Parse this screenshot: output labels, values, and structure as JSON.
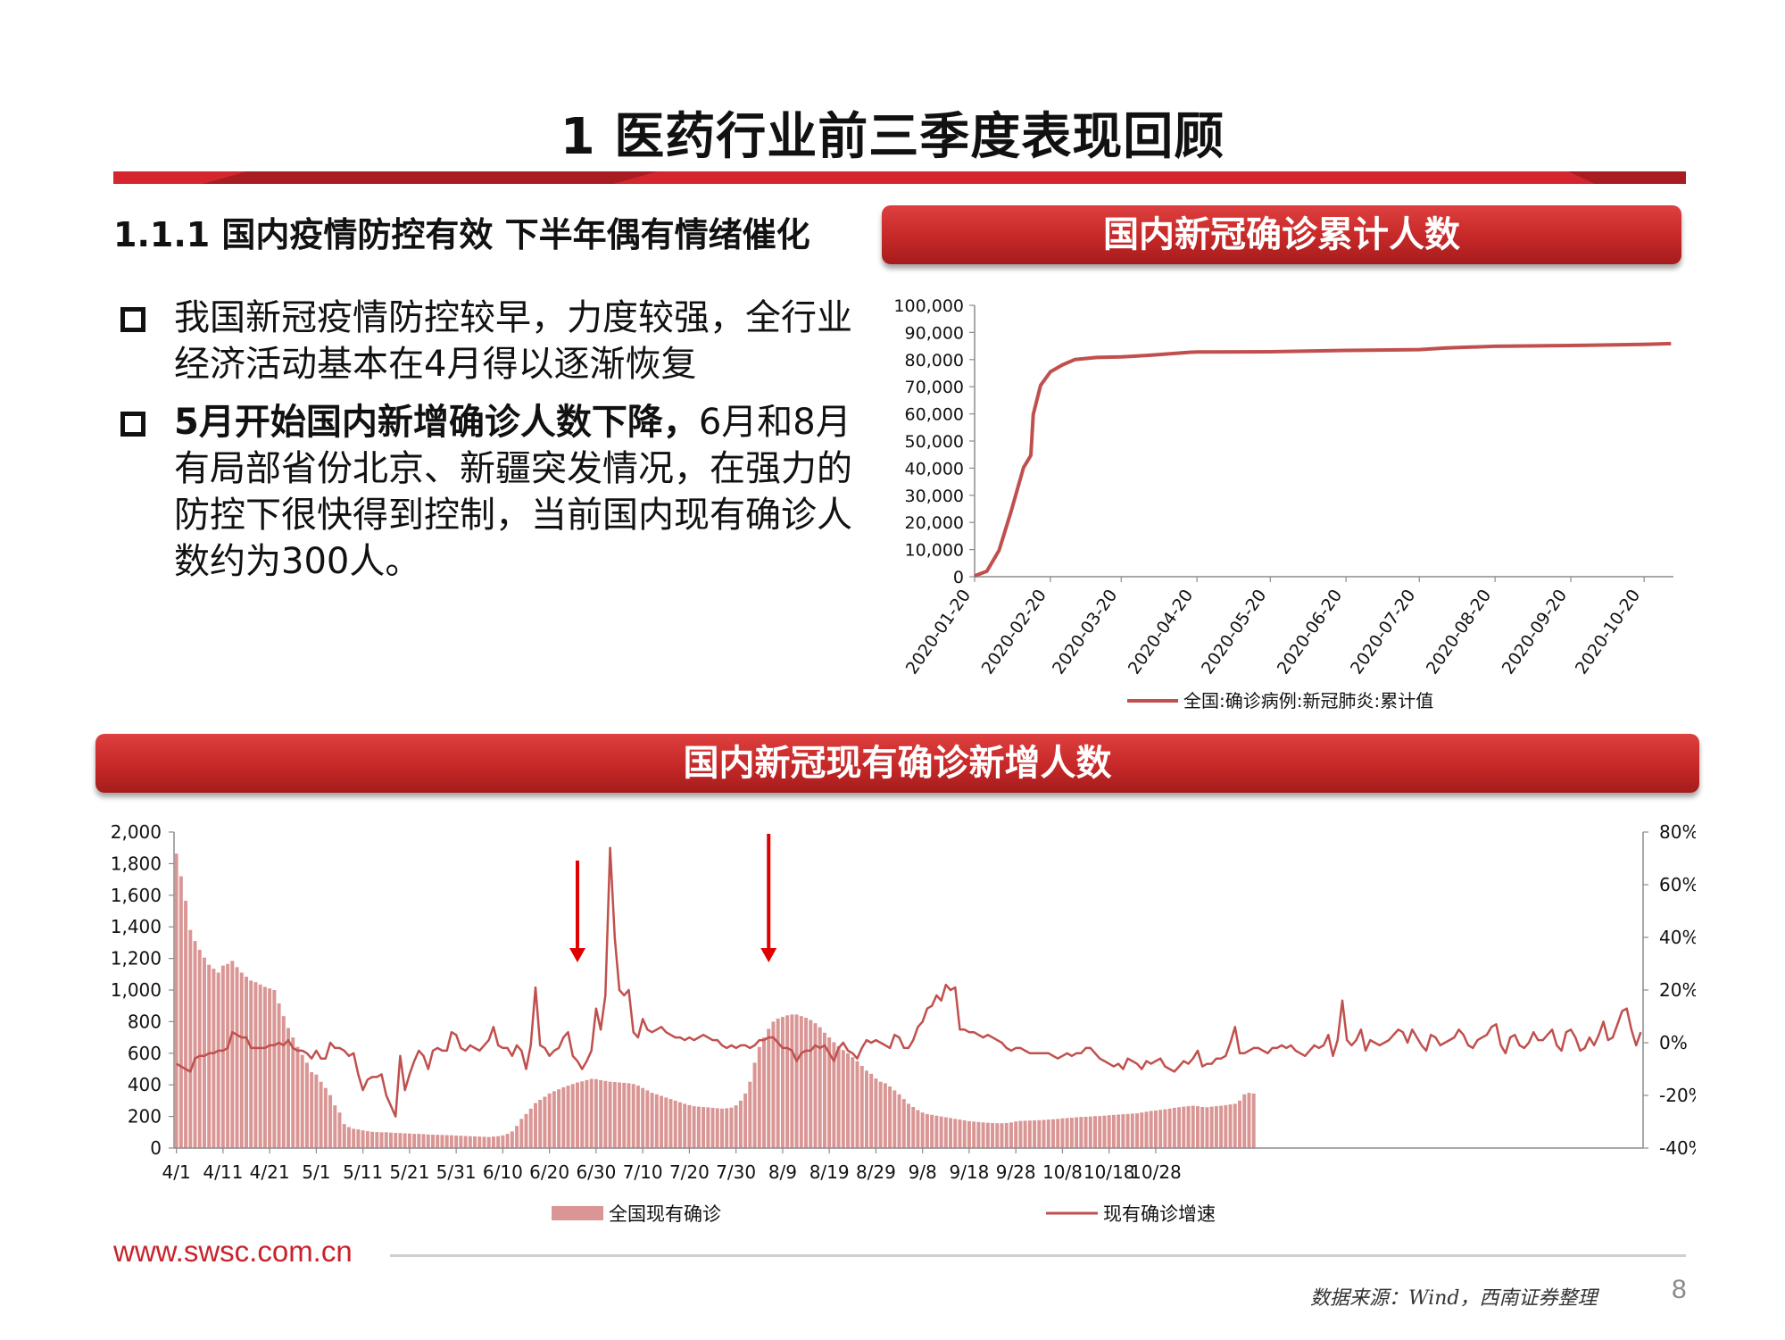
{
  "header": {
    "title": "1 医药行业前三季度表现回顾"
  },
  "section": {
    "heading": "1.1.1 国内疫情防控有效 下半年偶有情绪催化",
    "bullets": [
      {
        "bold": "",
        "text": "我国新冠疫情防控较早，力度较强，全行业经济活动基本在4月得以逐渐恢复"
      },
      {
        "bold": "5月开始国内新增确诊人数下降，",
        "text": "6月和8月有局部省份北京、新疆突发情况，在强力的防控下很快得到控制，当前国内现有确诊人数约为300人。"
      }
    ]
  },
  "colors": {
    "brand_red": "#c8232c",
    "line": "#c0504d",
    "bar": "#d99694",
    "arrow": "#e00000"
  },
  "chart_data": [
    {
      "type": "line",
      "title": "国内新冠确诊累计人数",
      "xlabel": "",
      "ylabel": "",
      "ylim": [
        0,
        100000
      ],
      "yticks": [
        "0",
        "10,000",
        "20,000",
        "30,000",
        "40,000",
        "50,000",
        "60,000",
        "70,000",
        "80,000",
        "90,000",
        "100,000"
      ],
      "xticks": [
        "2020-01-20",
        "2020-02-20",
        "2020-03-20",
        "2020-04-20",
        "2020-05-20",
        "2020-06-20",
        "2020-07-20",
        "2020-08-20",
        "2020-09-20",
        "2020-10-20"
      ],
      "grid": false,
      "legend": "bottom",
      "series": [
        {
          "name": "全国:确诊病例:新冠肺炎:累计值",
          "x": [
            "2020-01-20",
            "2020-01-25",
            "2020-01-30",
            "2020-02-04",
            "2020-02-09",
            "2020-02-12",
            "2020-02-13",
            "2020-02-16",
            "2020-02-20",
            "2020-02-25",
            "2020-03-01",
            "2020-03-10",
            "2020-03-20",
            "2020-04-01",
            "2020-04-17",
            "2020-04-20",
            "2020-05-20",
            "2020-06-20",
            "2020-07-20",
            "2020-07-31",
            "2020-08-20",
            "2020-09-20",
            "2020-10-20",
            "2020-10-31"
          ],
          "values": [
            300,
            2000,
            9700,
            24300,
            40200,
            44700,
            59800,
            70500,
            75500,
            78100,
            80000,
            80800,
            81000,
            81600,
            82700,
            82800,
            82900,
            83400,
            83700,
            84300,
            84900,
            85200,
            85600,
            85900
          ]
        }
      ]
    },
    {
      "type": "bar",
      "title": "国内新冠现有确诊新增人数",
      "xlabel": "",
      "ylabel": "",
      "ylim": [
        0,
        2000
      ],
      "y2lim": [
        -40,
        80
      ],
      "yticks": [
        "0",
        "200",
        "400",
        "600",
        "800",
        "1,000",
        "1,200",
        "1,400",
        "1,600",
        "1,800",
        "2,000"
      ],
      "y2ticks": [
        "-40%",
        "-20%",
        "0%",
        "20%",
        "40%",
        "60%",
        "80%"
      ],
      "xticks": [
        "4/1",
        "4/11",
        "4/21",
        "5/1",
        "5/11",
        "5/21",
        "5/31",
        "6/10",
        "6/20",
        "6/30",
        "7/10",
        "7/20",
        "7/30",
        "8/9",
        "8/19",
        "8/29",
        "9/8",
        "9/18",
        "9/28",
        "10/8",
        "10/18",
        "10/28"
      ],
      "legend": "bottom",
      "annotations": [
        {
          "type": "arrow",
          "x": "6/26"
        },
        {
          "type": "arrow",
          "x": "8/6"
        }
      ],
      "series": [
        {
          "name": "全国现有确诊",
          "axis": "left",
          "kind": "bar",
          "values": [
            1863,
            1720,
            1565,
            1380,
            1310,
            1255,
            1205,
            1160,
            1135,
            1110,
            1155,
            1165,
            1185,
            1145,
            1110,
            1085,
            1060,
            1050,
            1035,
            1020,
            1010,
            1000,
            915,
            835,
            760,
            700,
            640,
            590,
            540,
            480,
            465,
            420,
            380,
            335,
            270,
            225,
            152,
            133,
            122,
            118,
            112,
            107,
            103,
            101,
            100,
            100,
            98,
            96,
            95,
            93,
            92,
            90,
            90,
            88,
            86,
            85,
            84,
            83,
            82,
            81,
            79,
            78,
            76,
            75,
            74,
            73,
            72,
            70,
            73,
            75,
            80,
            90,
            105,
            140,
            185,
            215,
            250,
            285,
            305,
            325,
            345,
            360,
            372,
            385,
            395,
            405,
            415,
            422,
            430,
            438,
            436,
            430,
            425,
            420,
            418,
            415,
            413,
            410,
            405,
            395,
            380,
            365,
            350,
            340,
            330,
            320,
            310,
            300,
            290,
            280,
            272,
            265,
            262,
            260,
            258,
            255,
            252,
            250,
            252,
            256,
            270,
            300,
            345,
            420,
            540,
            640,
            700,
            755,
            800,
            820,
            830,
            840,
            845,
            845,
            835,
            825,
            810,
            790,
            765,
            730,
            700,
            670,
            645,
            620,
            600,
            575,
            550,
            520,
            490,
            470,
            440,
            420,
            410,
            390,
            365,
            340,
            310,
            280,
            260,
            240,
            225,
            215,
            210,
            205,
            200,
            195,
            190,
            185,
            180,
            175,
            170,
            168,
            165,
            162,
            160,
            158,
            157,
            157,
            158,
            162,
            168,
            172,
            173,
            174,
            175,
            176,
            178,
            180,
            182,
            185,
            188,
            190,
            192,
            195,
            197,
            198,
            200,
            202,
            203,
            205,
            208,
            210,
            212,
            214,
            216,
            218,
            220,
            225,
            230,
            235,
            238,
            242,
            245,
            250,
            255,
            258,
            262,
            265,
            268,
            265,
            260,
            258,
            262,
            265,
            268,
            272,
            276,
            280,
            300,
            340,
            350,
            345
          ]
        },
        {
          "name": "现有确诊增速",
          "axis": "right",
          "kind": "line",
          "values": [
            -8,
            -9,
            -10,
            -11,
            -6,
            -5,
            -5,
            -4,
            -4,
            -3,
            -3,
            -2,
            4,
            3,
            2,
            2,
            -2,
            -2,
            -2,
            -2,
            -1,
            -1,
            0,
            -1,
            1,
            -2,
            -3,
            -3,
            -4,
            -6,
            -3,
            -6,
            -6,
            0,
            -2,
            -2,
            -3,
            -5,
            -4,
            -12,
            -18,
            -14,
            -13,
            -13,
            -12,
            -20,
            -24,
            -28,
            -5,
            -18,
            -12,
            -7,
            -3,
            -5,
            -10,
            -3,
            -2,
            -3,
            -3,
            4,
            3,
            -2,
            -3,
            -1,
            -2,
            -3,
            -1,
            1,
            6,
            -1,
            -2,
            -2,
            -5,
            -1,
            -3,
            -10,
            -1,
            21,
            -1,
            -2,
            -5,
            -3,
            -2,
            2,
            4,
            -5,
            -7,
            -10,
            -7,
            -3,
            13,
            5,
            18,
            74,
            40,
            20,
            18,
            20,
            4,
            2,
            9,
            5,
            4,
            5,
            6,
            4,
            3,
            2,
            2,
            1,
            2,
            1,
            2,
            3,
            2,
            1,
            1,
            -1,
            -2,
            -1,
            -2,
            -1,
            -1,
            -2,
            -1,
            1,
            1,
            2,
            2,
            0,
            -2,
            -2,
            -3,
            -7,
            -4,
            -3,
            -3,
            -1,
            -2,
            -1,
            -4,
            -7,
            -2,
            0,
            -3,
            -4,
            -6,
            -2,
            1,
            0,
            1,
            0,
            -1,
            -2,
            3,
            2,
            -2,
            -2,
            1,
            6,
            8,
            13,
            14,
            18,
            16,
            22,
            20,
            21,
            5,
            5,
            4,
            4,
            3,
            2,
            3,
            2,
            1,
            0,
            -2,
            -3,
            -2,
            -2,
            -3,
            -4,
            -4,
            -4,
            -4,
            -4,
            -5,
            -6,
            -5,
            -4,
            -5,
            -4,
            -4,
            -2,
            -2,
            -4,
            -6,
            -7,
            -8,
            -9,
            -8,
            -10,
            -6,
            -7,
            -8,
            -10,
            -7,
            -8,
            -7,
            -6,
            -9,
            -10,
            -11,
            -9,
            -7,
            -8,
            -6,
            -3,
            -9,
            -8,
            -8,
            -6,
            -6,
            -5,
            0,
            6,
            -4,
            -4,
            -3,
            -2,
            -2,
            -3,
            -4,
            -2,
            -2,
            -1,
            -2,
            -1,
            -3,
            -4,
            -5,
            -3,
            -1,
            -2,
            -1,
            3,
            -5,
            1,
            16,
            1,
            -1,
            1,
            5,
            -3,
            1,
            0,
            -1,
            0,
            1,
            3,
            5,
            4,
            0,
            5,
            2,
            -1,
            -3,
            3,
            2,
            -1,
            0,
            1,
            2,
            5,
            3,
            -1,
            -2,
            1,
            2,
            3,
            6,
            7,
            -1,
            -4,
            2,
            3,
            -1,
            -2,
            0,
            4,
            1,
            1,
            3,
            5,
            -1,
            -3,
            4,
            5,
            2,
            -3,
            -2,
            2,
            -1,
            3,
            8,
            1,
            2,
            7,
            12,
            13,
            5,
            -1,
            4
          ]
        }
      ]
    }
  ],
  "footer": {
    "url": "www.swsc.com.cn",
    "source": "数据来源：Wind，西南证券整理",
    "page": "8"
  }
}
